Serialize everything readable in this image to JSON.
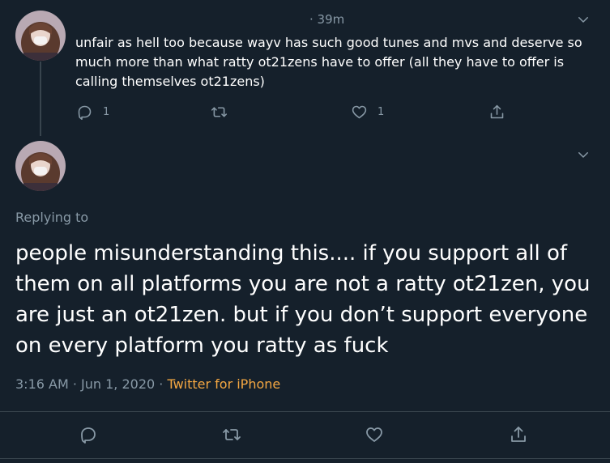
{
  "colors": {
    "background": "#15202b",
    "text_primary": "#ffffff",
    "text_secondary": "#8899a6",
    "source_link": "#f4a742",
    "border": "#38444d"
  },
  "tweet1": {
    "time": "· 39m",
    "text": "unfair as hell too because wayv has such good tunes and mvs and deserve so much more than what ratty ot21zens have to offer (all they have to offer is calling themselves ot21zens)",
    "actions": {
      "reply_icon": "reply-icon",
      "reply_count": "1",
      "retweet_icon": "retweet-icon",
      "like_icon": "heart-icon",
      "like_count": "1",
      "share_icon": "share-icon"
    }
  },
  "tweet2": {
    "replying_to": "Replying to",
    "text": "people misunderstanding this.... if you support all of them on all platforms you are not a ratty ot21zen, you are just an ot21zen. but if you don’t support everyone on every platform you ratty as fuck",
    "timestamp": "3:16 AM · Jun 1, 2020 · ",
    "source": "Twitter for iPhone",
    "actions": [
      "reply-icon",
      "retweet-icon",
      "heart-icon",
      "share-icon"
    ]
  }
}
